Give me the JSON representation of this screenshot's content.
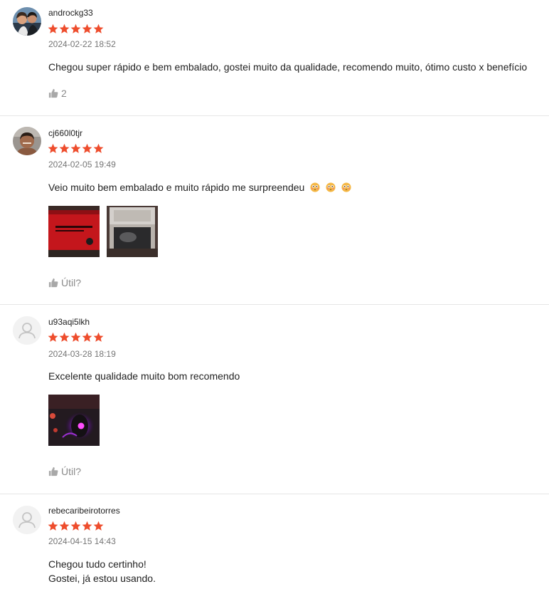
{
  "accent_color": "#ee4d2d",
  "reviews": [
    {
      "username": "androckg33",
      "rating": 5,
      "date": "2024-02-22 18:52",
      "comment_lines": [
        "Chegou super rápido e bem embalado, gostei muito da qualidade, recomendo muito, ótimo custo x benefício"
      ],
      "like_label": "2",
      "avatar": "couple-selfie",
      "photos": []
    },
    {
      "username": "cj660l0tjr",
      "rating": 5,
      "date": "2024-02-05 19:49",
      "comment_lines": [
        "Veio muito bem embalado e muito rápido me surpreendeu"
      ],
      "comment_emoji": "flushed-face-emoji",
      "like_label": "Útil?",
      "avatar": "man-selfie",
      "photos": [
        "red-product-box-photo",
        "opened-box-mousepad-photo"
      ]
    },
    {
      "username": "u93aqi5lkh",
      "rating": 5,
      "date": "2024-03-28 18:19",
      "comment_lines": [
        "Excelente qualidade muito bom recomendo"
      ],
      "like_label": "Útil?",
      "avatar": "default-user-icon",
      "photos": [
        "purple-lit-mouse-photo"
      ]
    },
    {
      "username": "rebecaribeirotorres",
      "rating": 5,
      "date": "2024-04-15 14:43",
      "comment_lines": [
        "Chegou tudo certinho!",
        "Gostei, já estou usando."
      ],
      "avatar": "default-user-icon",
      "photos": []
    }
  ]
}
